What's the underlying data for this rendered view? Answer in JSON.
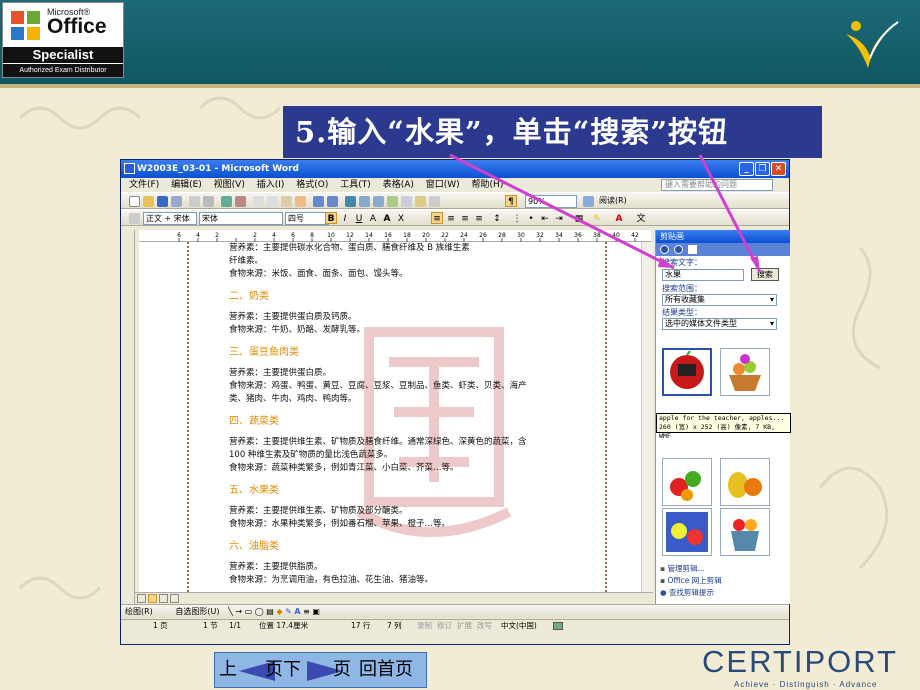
{
  "slide": {
    "logo": {
      "brand_small": "Microsoft®",
      "brand": "Office",
      "title": "Specialist",
      "subtitle": "Authorized Exam Distributor"
    },
    "instruction": "5.输入“水果”，单击“搜索”按钮",
    "nav": {
      "prev": "上",
      "next_prefix": "页下",
      "next_suffix": "页",
      "home": "回首页"
    },
    "footer_brand": "CERTIPORT",
    "footer_tagline": "Achieve · Distinguish · Advance",
    "colors": {
      "banner": "#146170",
      "instruction_bg": "#2b3a8f",
      "heading": "#e08b00",
      "arrow": "#d040d0"
    }
  },
  "word": {
    "title": "W2003E_03-01 - Microsoft Word",
    "menu": [
      "文件(F)",
      "编辑(E)",
      "视图(V)",
      "插入(I)",
      "格式(O)",
      "工具(T)",
      "表格(A)",
      "窗口(W)",
      "帮助(H)"
    ],
    "help_placeholder": "键入需要帮助的问题",
    "style_combo": "正文 + 宋体",
    "font_combo": "宋体",
    "size_combo": "四号",
    "zoom_combo": "90%",
    "read_label": "阅读(R)",
    "ruler_ticks": [
      "6",
      "4",
      "2",
      "",
      "2",
      "4",
      "6",
      "8",
      "10",
      "12",
      "14",
      "16",
      "18",
      "20",
      "22",
      "24",
      "26",
      "28",
      "30",
      "32",
      "34",
      "36",
      "38",
      "40",
      "42"
    ],
    "doc": [
      {
        "type": "p",
        "text": "营养素：主要提供碳水化合物、蛋白质、膳食纤维及 B 族维生素"
      },
      {
        "type": "p",
        "text": "纤维素。"
      },
      {
        "type": "p",
        "text": "食物来源：米饭、面食、面条、面包、馒头等。"
      },
      {
        "type": "h",
        "text": "二、奶类"
      },
      {
        "type": "p",
        "text": "营养素：主要提供蛋白质及钙质。"
      },
      {
        "type": "p",
        "text": "食物来源：牛奶、奶酪、发酵乳等。"
      },
      {
        "type": "h",
        "text": "三、蛋豆鱼肉类"
      },
      {
        "type": "p",
        "text": "营养素：主要提供蛋白质。"
      },
      {
        "type": "p",
        "text": "食物来源：鸡蛋、鸭蛋、黄豆、豆腐、豆浆、豆制品、鱼类、虾类、贝类、海产"
      },
      {
        "type": "p",
        "text": "类、猪肉、牛肉、鸡肉、鸭肉等。"
      },
      {
        "type": "h",
        "text": "四、蔬菜类"
      },
      {
        "type": "p",
        "text": "营养素：主要提供维生素、矿物质及膳食纤维。通常深绿色、深黄色的蔬菜，含"
      },
      {
        "type": "p",
        "text": "100 种维生素及矿物质的量比浅色蔬菜多。"
      },
      {
        "type": "p",
        "text": "食物来源：蔬菜种类繁多，例如青江菜、小白菜、芥菜…等。"
      },
      {
        "type": "h",
        "text": "五、水果类"
      },
      {
        "type": "p",
        "text": "营养素：主要提供维生素、矿物质及部分醣类。"
      },
      {
        "type": "p",
        "text": "食物来源：水果种类繁多，例如番石榴、苹果、橙子…等。"
      },
      {
        "type": "h",
        "text": "六、油脂类"
      },
      {
        "type": "p",
        "text": "营养素：主要提供脂质。"
      },
      {
        "type": "p",
        "text": "食物来源：为烹调用油，有色拉油、花生油、猪油等。"
      }
    ],
    "clipart_pane": {
      "title": "剪贴画",
      "search_label": "搜索文字：",
      "search_value": "水果",
      "search_button": "搜索",
      "scope_label": "搜索范围：",
      "scope_value": "所有收藏集",
      "types_label": "结果类型：",
      "types_value": "选中的媒体文件类型",
      "tooltip_line1": "apple for the teacher, apples...",
      "tooltip_line2": "260 (宽) x 252 (高) 像素, 7 KB, WMF",
      "links": [
        "管理剪辑...",
        "Office 网上剪辑",
        "查找剪辑提示"
      ]
    },
    "drawbar": {
      "draw": "绘图(R)",
      "autoshapes": "自选图形(U)"
    },
    "status": {
      "page": "1 页",
      "section": "1 节",
      "pages": "1/1",
      "position": "位置 17.4厘米",
      "line": "17 行",
      "col": "7 列",
      "rec": "录制",
      "trk": "修订",
      "ext": "扩展",
      "ovr": "改写",
      "lang": "中文(中国)"
    }
  }
}
